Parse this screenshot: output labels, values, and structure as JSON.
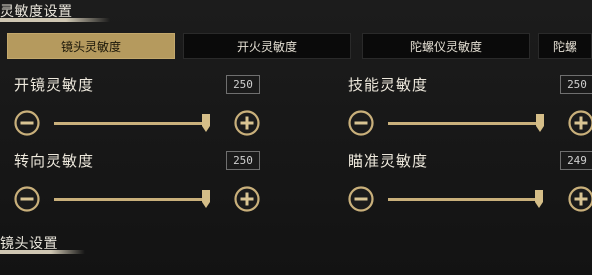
{
  "sections": {
    "sensitivity": {
      "title": "灵敏度设置"
    },
    "scope": {
      "title": "镜头设置"
    }
  },
  "tabs": [
    {
      "label": "镜头灵敏度",
      "active": true
    },
    {
      "label": "开火灵敏度",
      "active": false
    },
    {
      "label": "陀螺仪灵敏度",
      "active": false
    },
    {
      "label": "陀螺",
      "active": false
    }
  ],
  "sliders": [
    {
      "label": "开镜灵敏度",
      "value": "250",
      "level": 1.0
    },
    {
      "label": "技能灵敏度",
      "value": "250",
      "level": 1.0
    },
    {
      "label": "转向灵敏度",
      "value": "250",
      "level": 1.0
    },
    {
      "label": "瞄准灵敏度",
      "value": "249",
      "level": 0.996
    }
  ],
  "colors": {
    "accent": "#b59a5e",
    "track": "#c9b07b",
    "background": "#141414"
  },
  "icons": {
    "decrease": "minus-icon",
    "increase": "plus-icon"
  }
}
